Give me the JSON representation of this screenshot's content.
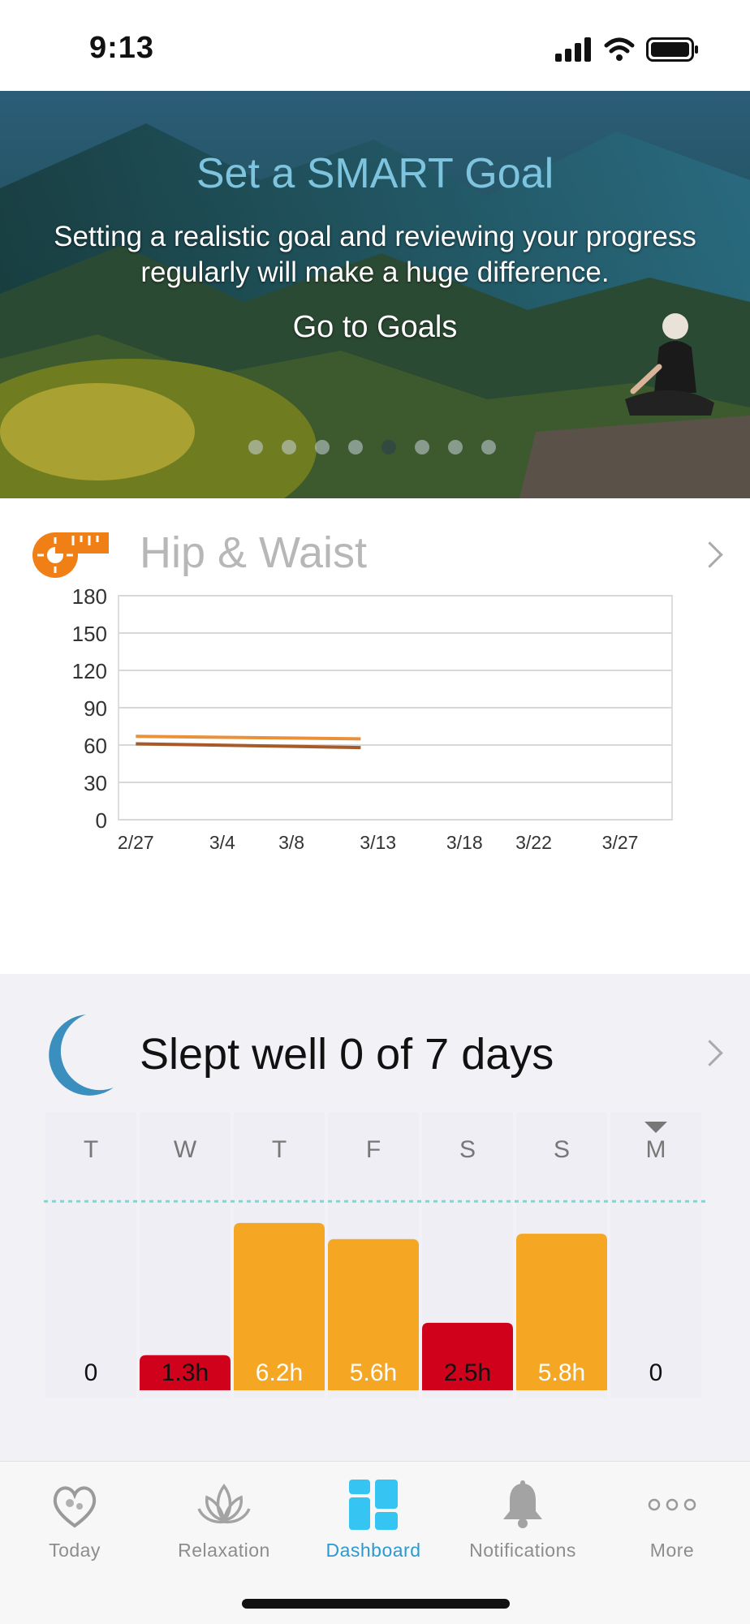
{
  "status_bar": {
    "time": "9:13",
    "icons": [
      "signal-icon",
      "wifi-icon",
      "battery-icon"
    ]
  },
  "hero": {
    "title": "Set a SMART Goal",
    "text": "Setting a realistic goal and reviewing your progress regularly will make a huge difference.",
    "link": "Go to Goals",
    "dots": {
      "count": 8,
      "active_index": 4
    }
  },
  "hip_card": {
    "title": "Hip & Waist",
    "icon": "tape-measure-icon",
    "chart_data": {
      "type": "line",
      "title": "",
      "xlabel": "",
      "ylabel": "",
      "x_ticks": [
        "2/27",
        "3/4",
        "3/8",
        "3/13",
        "3/18",
        "3/22",
        "3/27"
      ],
      "y_ticks": [
        0,
        30,
        60,
        90,
        120,
        150,
        180
      ],
      "y_tick_labels": [
        "0",
        "30",
        "60",
        "90",
        "120",
        "150",
        "180"
      ],
      "xlim": [
        "2/26",
        "3/30"
      ],
      "ylim": [
        0,
        180
      ],
      "grid": true,
      "series": [
        {
          "color": "#e8913a",
          "x": [
            "2/27",
            "3/12"
          ],
          "y": [
            67,
            65
          ]
        },
        {
          "color": "#a85a2a",
          "x": [
            "2/27",
            "3/12"
          ],
          "y": [
            61,
            58
          ]
        }
      ]
    }
  },
  "sleep_card": {
    "title": "Slept well 0 of 7 days",
    "icon": "moon-icon",
    "chart_data": {
      "type": "bar",
      "title": "",
      "categories": [
        "T",
        "W",
        "T",
        "F",
        "S",
        "S",
        "M"
      ],
      "values": [
        0,
        1.3,
        6.2,
        5.6,
        2.5,
        5.8,
        0
      ],
      "labels": [
        "0",
        "1.3h",
        "6.2h",
        "5.6h",
        "2.5h",
        "5.8h",
        "0"
      ],
      "bar_colors": [
        "#f5a623",
        "#d0021b",
        "#f5a623",
        "#f5a623",
        "#d0021b",
        "#f5a623",
        "#f5a623"
      ],
      "goal_line": 7,
      "ylim": [
        0,
        8.6
      ],
      "selected_index": 6
    }
  },
  "tabs": [
    {
      "label": "Today",
      "icon": "heart-people-icon",
      "active": false
    },
    {
      "label": "Relaxation",
      "icon": "lotus-icon",
      "active": false
    },
    {
      "label": "Dashboard",
      "icon": "dashboard-grid-icon",
      "active": true
    },
    {
      "label": "Notifications",
      "icon": "bell-icon",
      "active": false
    },
    {
      "label": "More",
      "icon": "more-dots-icon",
      "active": false
    }
  ],
  "colors": {
    "accent": "#2a9ad0",
    "orange": "#f5a623",
    "red": "#d0021b",
    "moon": "#3a8fbf",
    "tape": "#f07f16"
  }
}
